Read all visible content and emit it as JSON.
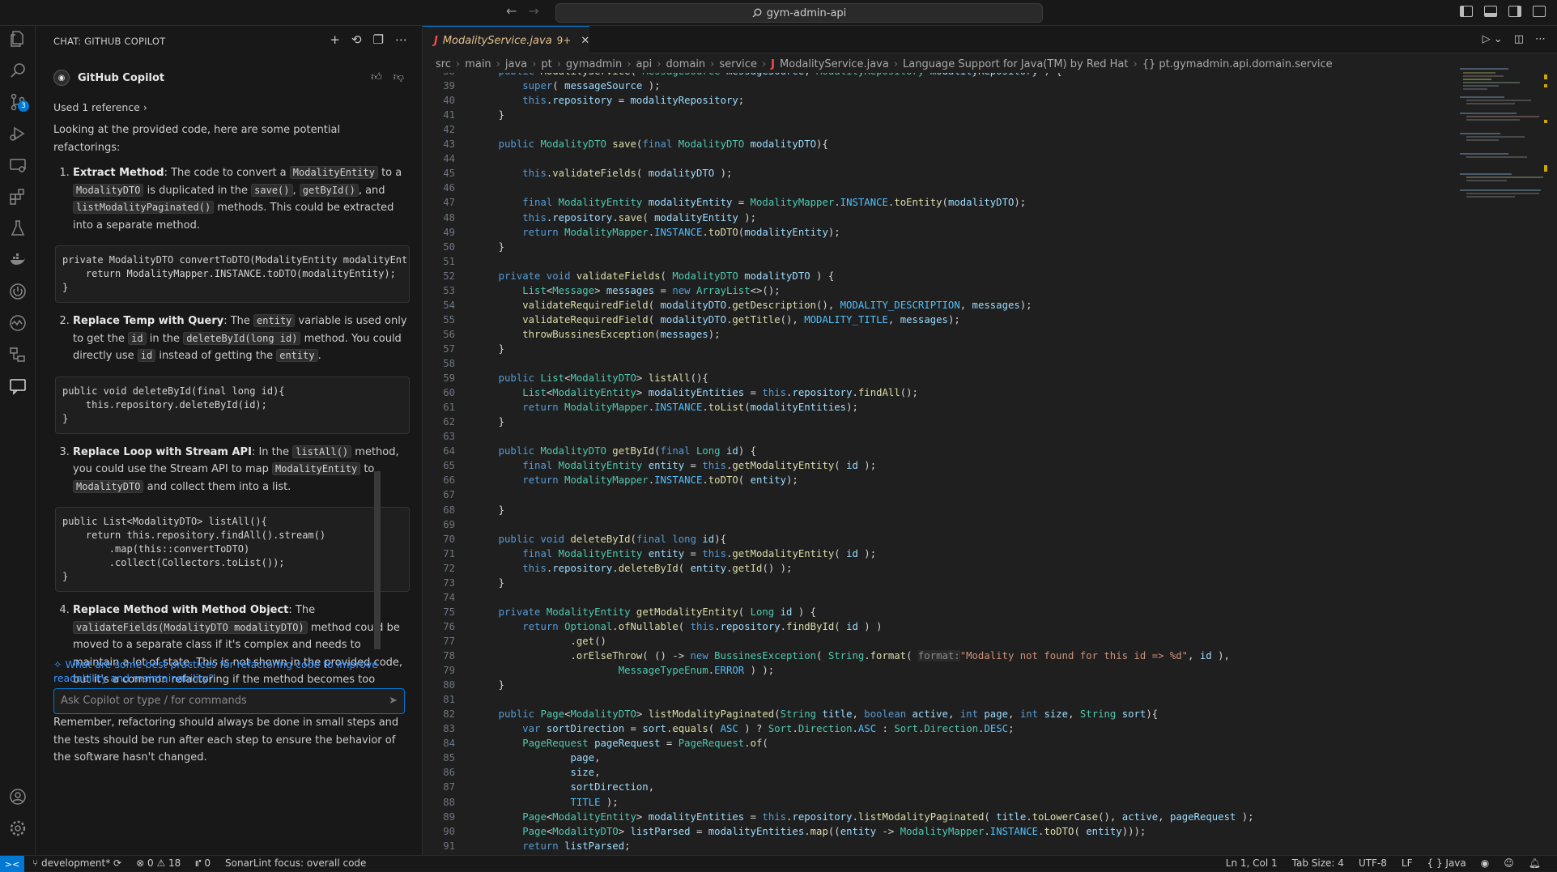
{
  "titlebar": {
    "search": "gym-admin-api"
  },
  "activity": {
    "scm_badge": "3"
  },
  "chat": {
    "header": "CHAT: GITHUB COPILOT",
    "author": "GitHub Copilot",
    "reference": "Used 1 reference",
    "intro": "Looking at the provided code, here are some potential refactorings:",
    "items": [
      {
        "title": "Extract Method",
        "t1": ": The code to convert a ",
        "c1": "ModalityEntity",
        "t2": " to a ",
        "c2": "ModalityDTO",
        "t3": " is duplicated in the ",
        "c3": "save()",
        "t4": ", ",
        "c4": "getById()",
        "t5": ", and ",
        "c5": "listModalityPaginated()",
        "t6": " methods. This could be extracted into a separate method.",
        "code": "private ModalityDTO convertToDTO(ModalityEntity modalityEnt\n    return ModalityMapper.INSTANCE.toDTO(modalityEntity);\n}"
      },
      {
        "title": "Replace Temp with Query",
        "t1": ": The ",
        "c1": "entity",
        "t2": " variable is used only to get the ",
        "c2": "id",
        "t3": " in the ",
        "c3": "deleteById(long id)",
        "t4": " method. You could directly use ",
        "c4": "id",
        "t5": " instead of getting the ",
        "c5": "entity",
        "t6": ".",
        "code": "public void deleteById(final long id){\n    this.repository.deleteById(id);\n}"
      },
      {
        "title": "Replace Loop with Stream API",
        "t1": ": In the ",
        "c1": "listAll()",
        "t2": " method, you could use the Stream API to map ",
        "c2": "ModalityEntity",
        "t3": " to ",
        "c3": "ModalityDTO",
        "t4": " and collect them into a list.",
        "c4": "",
        "t5": "",
        "c5": "",
        "t6": "",
        "code": "public List<ModalityDTO> listAll(){\n    return this.repository.findAll().stream()\n        .map(this::convertToDTO)\n        .collect(Collectors.toList());\n}"
      },
      {
        "title": "Replace Method with Method Object",
        "t1": ": The ",
        "c1": "validateFields(ModalityDTO modalityDTO)",
        "t2": " method could be moved to a separate class if it's complex and needs to maintain a lot of state. This is not shown in the provided code, but it's a common refactoring if the method becomes too complex.",
        "c2": "",
        "t3": "",
        "c3": "",
        "t4": "",
        "c4": "",
        "t5": "",
        "c5": "",
        "t6": ""
      }
    ],
    "closing": "Remember, refactoring should always be done in small steps and the tests should be run after each step to ensure the behavior of the software hasn't changed.",
    "suggestion": "What are some best practices for refactoring code to improve readability and maintainability?",
    "input_placeholder": "Ask Copilot or type / for commands"
  },
  "editor": {
    "tab": {
      "icon": "J",
      "name": "ModalityService.java",
      "problems": "9+"
    },
    "breadcrumb": [
      "src",
      "main",
      "java",
      "pt",
      "gymadmin",
      "api",
      "domain",
      "service",
      "J",
      "ModalityService.java",
      "Language Support for Java(TM) by Red Hat",
      "{} pt.gymadmin.api.domain.service"
    ],
    "first_line": 38
  },
  "status": {
    "branch": "development*",
    "errors": "0",
    "warnings": "18",
    "ports": "0",
    "sonar": "SonarLint focus: overall code",
    "position": "Ln 1, Col 1",
    "tab_size": "Tab Size: 4",
    "encoding": "UTF-8",
    "eol": "LF",
    "language": "{ } Java"
  }
}
